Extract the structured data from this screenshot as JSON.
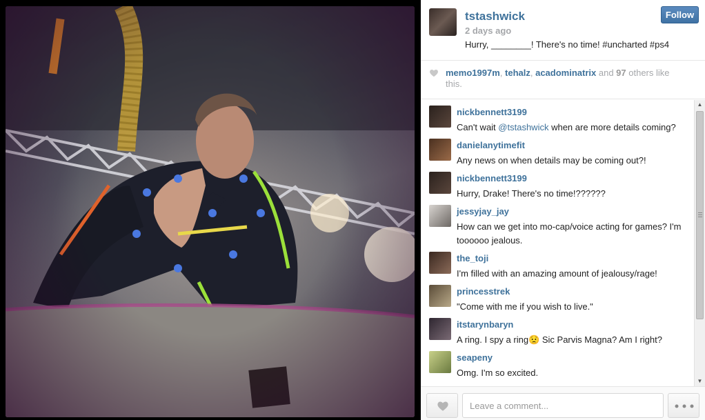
{
  "post": {
    "author": "tstashwick",
    "time": "2 days ago",
    "caption": "Hurry, ________! There's no time! #uncharted #ps4",
    "follow_label": "Follow"
  },
  "likes": {
    "users": [
      "memo1997m",
      "tehalz",
      "acadominatrix"
    ],
    "separator": ", ",
    "and_text": " and ",
    "count": "97",
    "suffix": " others like this."
  },
  "comments": [
    {
      "user": "nickbennett3199",
      "text_before": "Can't wait ",
      "mention": "@tstashwick",
      "text_after": " when are more details coming?",
      "avatar_color": "#3b2f2a"
    },
    {
      "user": "danielanytimefit",
      "text_before": "Any news on when details may be coming out?!",
      "mention": "",
      "text_after": "",
      "avatar_color": "#6b4a32"
    },
    {
      "user": "nickbennett3199",
      "text_before": "Hurry, Drake! There's no time!??????",
      "mention": "",
      "text_after": "",
      "avatar_color": "#3b2f2a"
    },
    {
      "user": "jessyjay_jay",
      "text_before": "How can we get into mo-cap/voice acting for games? I'm toooooo jealous.",
      "mention": "",
      "text_after": "",
      "avatar_color": "#b9b4b0"
    },
    {
      "user": "the_toji",
      "text_before": "I'm filled with an amazing amount of jealousy/rage!",
      "mention": "",
      "text_after": "",
      "avatar_color": "#5a3f33"
    },
    {
      "user": "princesstrek",
      "text_before": "\"Come with me if you wish to live.\"",
      "mention": "",
      "text_after": "",
      "avatar_color": "#8a7a62"
    },
    {
      "user": "itstarynbaryn",
      "text_before": "A ring. I spy a ring😟 Sic Parvis Magna? Am I right?",
      "mention": "",
      "text_after": "",
      "avatar_color": "#4a3e46"
    },
    {
      "user": "seapeny",
      "text_before": "Omg. I'm so excited.",
      "mention": "",
      "text_after": "",
      "avatar_color": "#a8b27a"
    }
  ],
  "footer": {
    "comment_placeholder": "Leave a comment..."
  },
  "colors": {
    "link": "#3f729b",
    "muted": "#a5a7aa",
    "follow_button": "#3f72a4"
  },
  "icons": {
    "like": "heart-icon",
    "more": "ellipsis-icon",
    "scroll_up": "triangle-up",
    "scroll_down": "triangle-down"
  }
}
